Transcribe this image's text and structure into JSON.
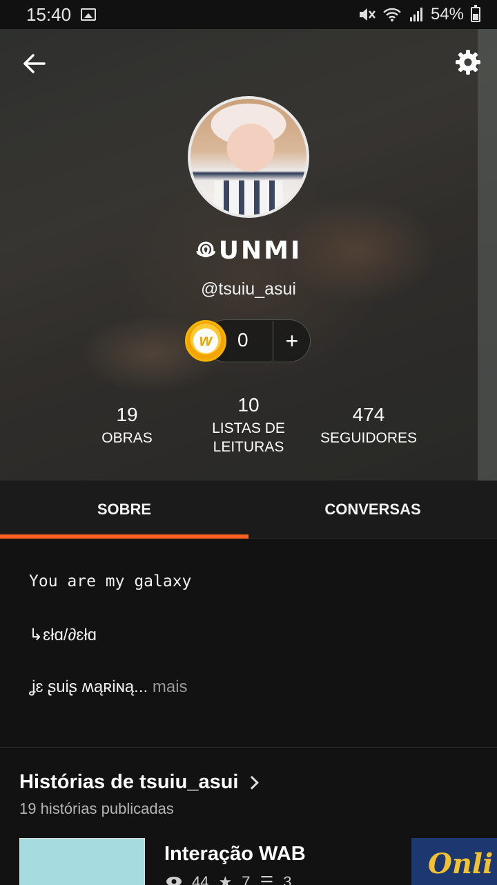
{
  "status_bar": {
    "time": "15:40",
    "battery": "54%"
  },
  "profile": {
    "display_name": "ꖘUNMI",
    "username": "@tsuiu_asui",
    "coins": "0",
    "coin_add": "+",
    "stats": [
      {
        "value": "19",
        "label": "OBRAS"
      },
      {
        "value": "10",
        "label": "LISTAS DE LEITURAS"
      },
      {
        "value": "474",
        "label": "SEGUIDORES"
      }
    ]
  },
  "tabs": {
    "about": "SOBRE",
    "conversations": "CONVERSAS",
    "active_color": "#ff6122"
  },
  "about": {
    "line1": "You are my galaxy",
    "line2": "↳ɛłɑ/∂ɛłɑ",
    "line3": "ʝɛ ʂuiʂ ʍąʀiɴą...",
    "more": "mais"
  },
  "stories": {
    "title": "Histórias de tsuiu_asui",
    "subtitle": "19 histórias publicadas",
    "items": [
      {
        "title": "Interação WAB",
        "views": "44",
        "votes": "7",
        "parts": "3"
      },
      {
        "cover_text": "Onli"
      }
    ]
  },
  "icons": {
    "back": "arrow-left-icon",
    "settings": "gear-icon",
    "coin": "wattpad-coin-icon"
  }
}
